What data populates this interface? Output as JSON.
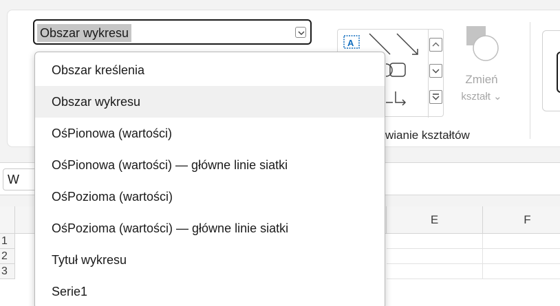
{
  "ribbon": {
    "element_selector": {
      "value": "Obszar wykresu"
    },
    "change_shape": {
      "line1": "Zmień",
      "line2": "kształt"
    },
    "group_label": "wianie kształtów"
  },
  "formula_bar": {
    "name_box_fragment": "W"
  },
  "sheet": {
    "columns": [
      "E",
      "F"
    ],
    "rows": [
      "1",
      "2",
      "3"
    ]
  },
  "dropdown": {
    "items": [
      "Obszar kreślenia",
      "Obszar wykresu",
      "OśPionowa (wartości)",
      "OśPionowa (wartości)  — główne linie siatki",
      "OśPozioma (wartości)",
      "OśPozioma (wartości)  — główne linie siatki",
      "Tytuł wykresu",
      "Serie1"
    ],
    "highlighted": "Obszar wykresu"
  },
  "colors": {
    "accent": "#0f6cbd",
    "highlight": "#f0f0f0",
    "disabled": "#a6a6a6"
  }
}
